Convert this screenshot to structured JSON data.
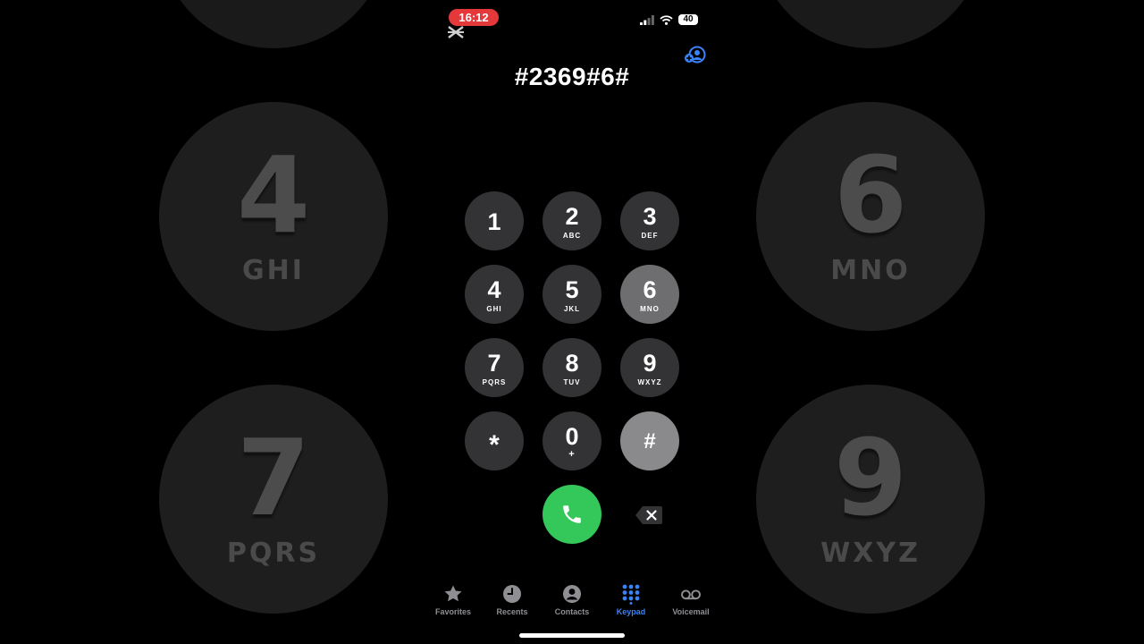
{
  "status_bar": {
    "time": "16:12",
    "battery": "40"
  },
  "dialed_number": "#2369#6#",
  "keypad": [
    {
      "digit": "1",
      "letters": ""
    },
    {
      "digit": "2",
      "letters": "ABC"
    },
    {
      "digit": "3",
      "letters": "DEF"
    },
    {
      "digit": "4",
      "letters": "GHI"
    },
    {
      "digit": "5",
      "letters": "JKL"
    },
    {
      "digit": "6",
      "letters": "MNO"
    },
    {
      "digit": "7",
      "letters": "PQRS"
    },
    {
      "digit": "8",
      "letters": "TUV"
    },
    {
      "digit": "9",
      "letters": "WXYZ"
    },
    {
      "digit": "*",
      "letters": ""
    },
    {
      "digit": "0",
      "letters": "+"
    },
    {
      "digit": "#",
      "letters": ""
    }
  ],
  "tabs": [
    {
      "label": "Favorites",
      "icon": "star-icon"
    },
    {
      "label": "Recents",
      "icon": "clock-icon"
    },
    {
      "label": "Contacts",
      "icon": "person-icon"
    },
    {
      "label": "Keypad",
      "icon": "keypad-icon"
    },
    {
      "label": "Voicemail",
      "icon": "voicemail-icon"
    }
  ],
  "active_tab": "Keypad",
  "background_zoom": {
    "keys": [
      {
        "digit": "4",
        "letters": "GHI"
      },
      {
        "digit": "6",
        "letters": "MNO"
      },
      {
        "digit": "7",
        "letters": "PQRS"
      },
      {
        "digit": "9",
        "letters": "WXYZ"
      }
    ]
  },
  "colors": {
    "accent_blue": "#3a82f7",
    "call_green": "#34c759",
    "key_gray": "#333335",
    "key_pressed": "#6e6e70",
    "time_pill_red": "#e5383b"
  }
}
